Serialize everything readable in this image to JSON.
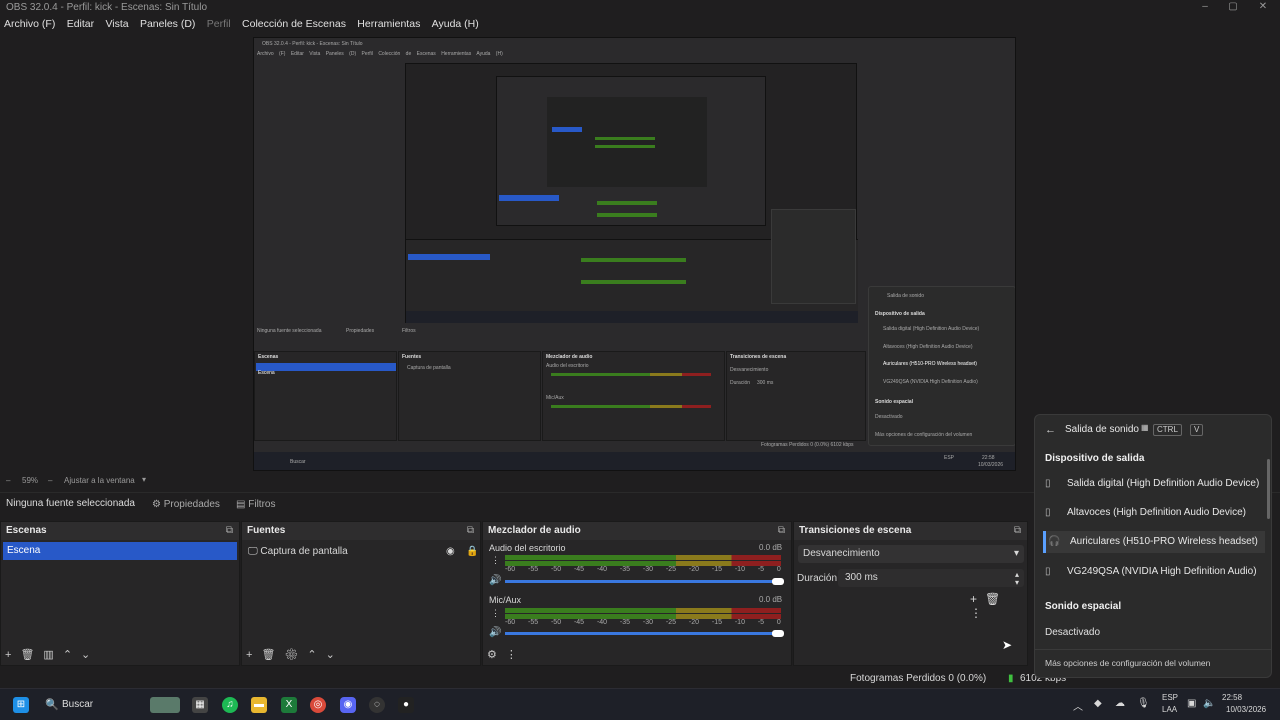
{
  "window": {
    "title": "OBS 32.0.4 - Perfil: kick - Escenas: Sin Título"
  },
  "menubar": {
    "items": [
      "Archivo (F)",
      "Editar",
      "Vista",
      "Paneles (D)",
      "Perfil",
      "Colección de Escenas",
      "Herramientas",
      "Ayuda (H)"
    ]
  },
  "preview": {
    "inner_title": "OBS 32.0.4 - Perfil: kick - Escenas: Sin Título",
    "inner_menu": [
      "Archivo (F)",
      "Editar",
      "Vista",
      "Paneles (D)",
      "Perfil",
      "Colección de Escenas",
      "Herramientas",
      "Ayuda (H)"
    ],
    "inner_no_source": "Ninguna fuente seleccionada",
    "inner_props": "Propiedades",
    "inner_filters": "Filtros",
    "inner_scenes_hdr": "Escenas",
    "inner_scene": "Escena",
    "inner_sources_hdr": "Fuentes",
    "inner_source": "Captura de pantalla",
    "inner_mixer_hdr": "Mezclador de audio",
    "inner_desktop": "Audio del escritorio",
    "inner_mic": "Mic/Aux",
    "inner_trans_hdr": "Transiciones de escena",
    "inner_fade": "Desvanecimiento",
    "inner_duration": "Duración",
    "inner_ms": "300 ms",
    "inner_status": "Fotogramas Perdidos 0 (0.0%)   6102 kbps",
    "inner_search": "Buscar",
    "inner_time": "22:58",
    "inner_date": "10/03/2026",
    "inner_lang": "ESP",
    "inner_flyout_title": "Salida de sonido",
    "inner_flyout_out": "Dispositivo de salida",
    "inner_flyout_items": [
      "Salida digital (High Definition Audio Device)",
      "Altavoces (High Definition Audio Device)",
      "Auriculares (H510-PRO Wireless headset)",
      "VG249QSA (NVIDIA High Definition Audio)"
    ],
    "inner_flyout_spatial": "Sonido espacial",
    "inner_flyout_off": "Desactivado",
    "inner_flyout_more": "Más opciones de configuración del volumen"
  },
  "zoom": {
    "value": "59%",
    "fit": "Ajustar a la ventana"
  },
  "source_bar": {
    "no_source": "Ninguna fuente seleccionada",
    "properties": "Propiedades",
    "filters": "Filtros"
  },
  "scenes": {
    "header": "Escenas",
    "items": [
      "Escena"
    ]
  },
  "sources": {
    "header": "Fuentes",
    "items": [
      "Captura de pantalla"
    ]
  },
  "mixer": {
    "header": "Mezclador de audio",
    "channels": [
      {
        "name": "Audio del escritorio",
        "db": "0.0 dB"
      },
      {
        "name": "Mic/Aux",
        "db": "0.0 dB"
      }
    ],
    "scale": [
      "-60",
      "-55",
      "-50",
      "-45",
      "-40",
      "-35",
      "-30",
      "-25",
      "-20",
      "-15",
      "-10",
      "-5",
      "0"
    ]
  },
  "transitions": {
    "header": "Transiciones de escena",
    "type": "Desvanecimiento",
    "duration_label": "Duración",
    "duration": "300 ms"
  },
  "status": {
    "dropped": "Fotogramas Perdidos 0 (0.0%)",
    "kbps": "6102 kbps"
  },
  "flyout": {
    "title": "Salida de sonido",
    "shortcut_ctrl": "CTRL",
    "shortcut_v": "V",
    "output_header": "Dispositivo de salida",
    "devices": [
      "Salida digital (High Definition Audio Device)",
      "Altavoces (High Definition Audio Device)",
      "Auriculares (H510-PRO Wireless headset)",
      "VG249QSA (NVIDIA High Definition Audio)"
    ],
    "selected_device": "Auriculares (H510-PRO Wireless headset)",
    "spatial_header": "Sonido espacial",
    "spatial_value": "Desactivado",
    "more": "Más opciones de configuración del volumen"
  },
  "taskbar": {
    "search": "Buscar",
    "lang1": "ESP",
    "lang2": "LAA",
    "time": "22:58",
    "date": "10/03/2026"
  },
  "colors": {
    "accent": "#2859c8",
    "bg": "#1f1e1f",
    "dock": "#272627",
    "taskbar": "#1e2028",
    "meter_green": "#3a7d1e",
    "meter_yellow": "#8a7a1c",
    "meter_red": "#8e1f1f"
  }
}
